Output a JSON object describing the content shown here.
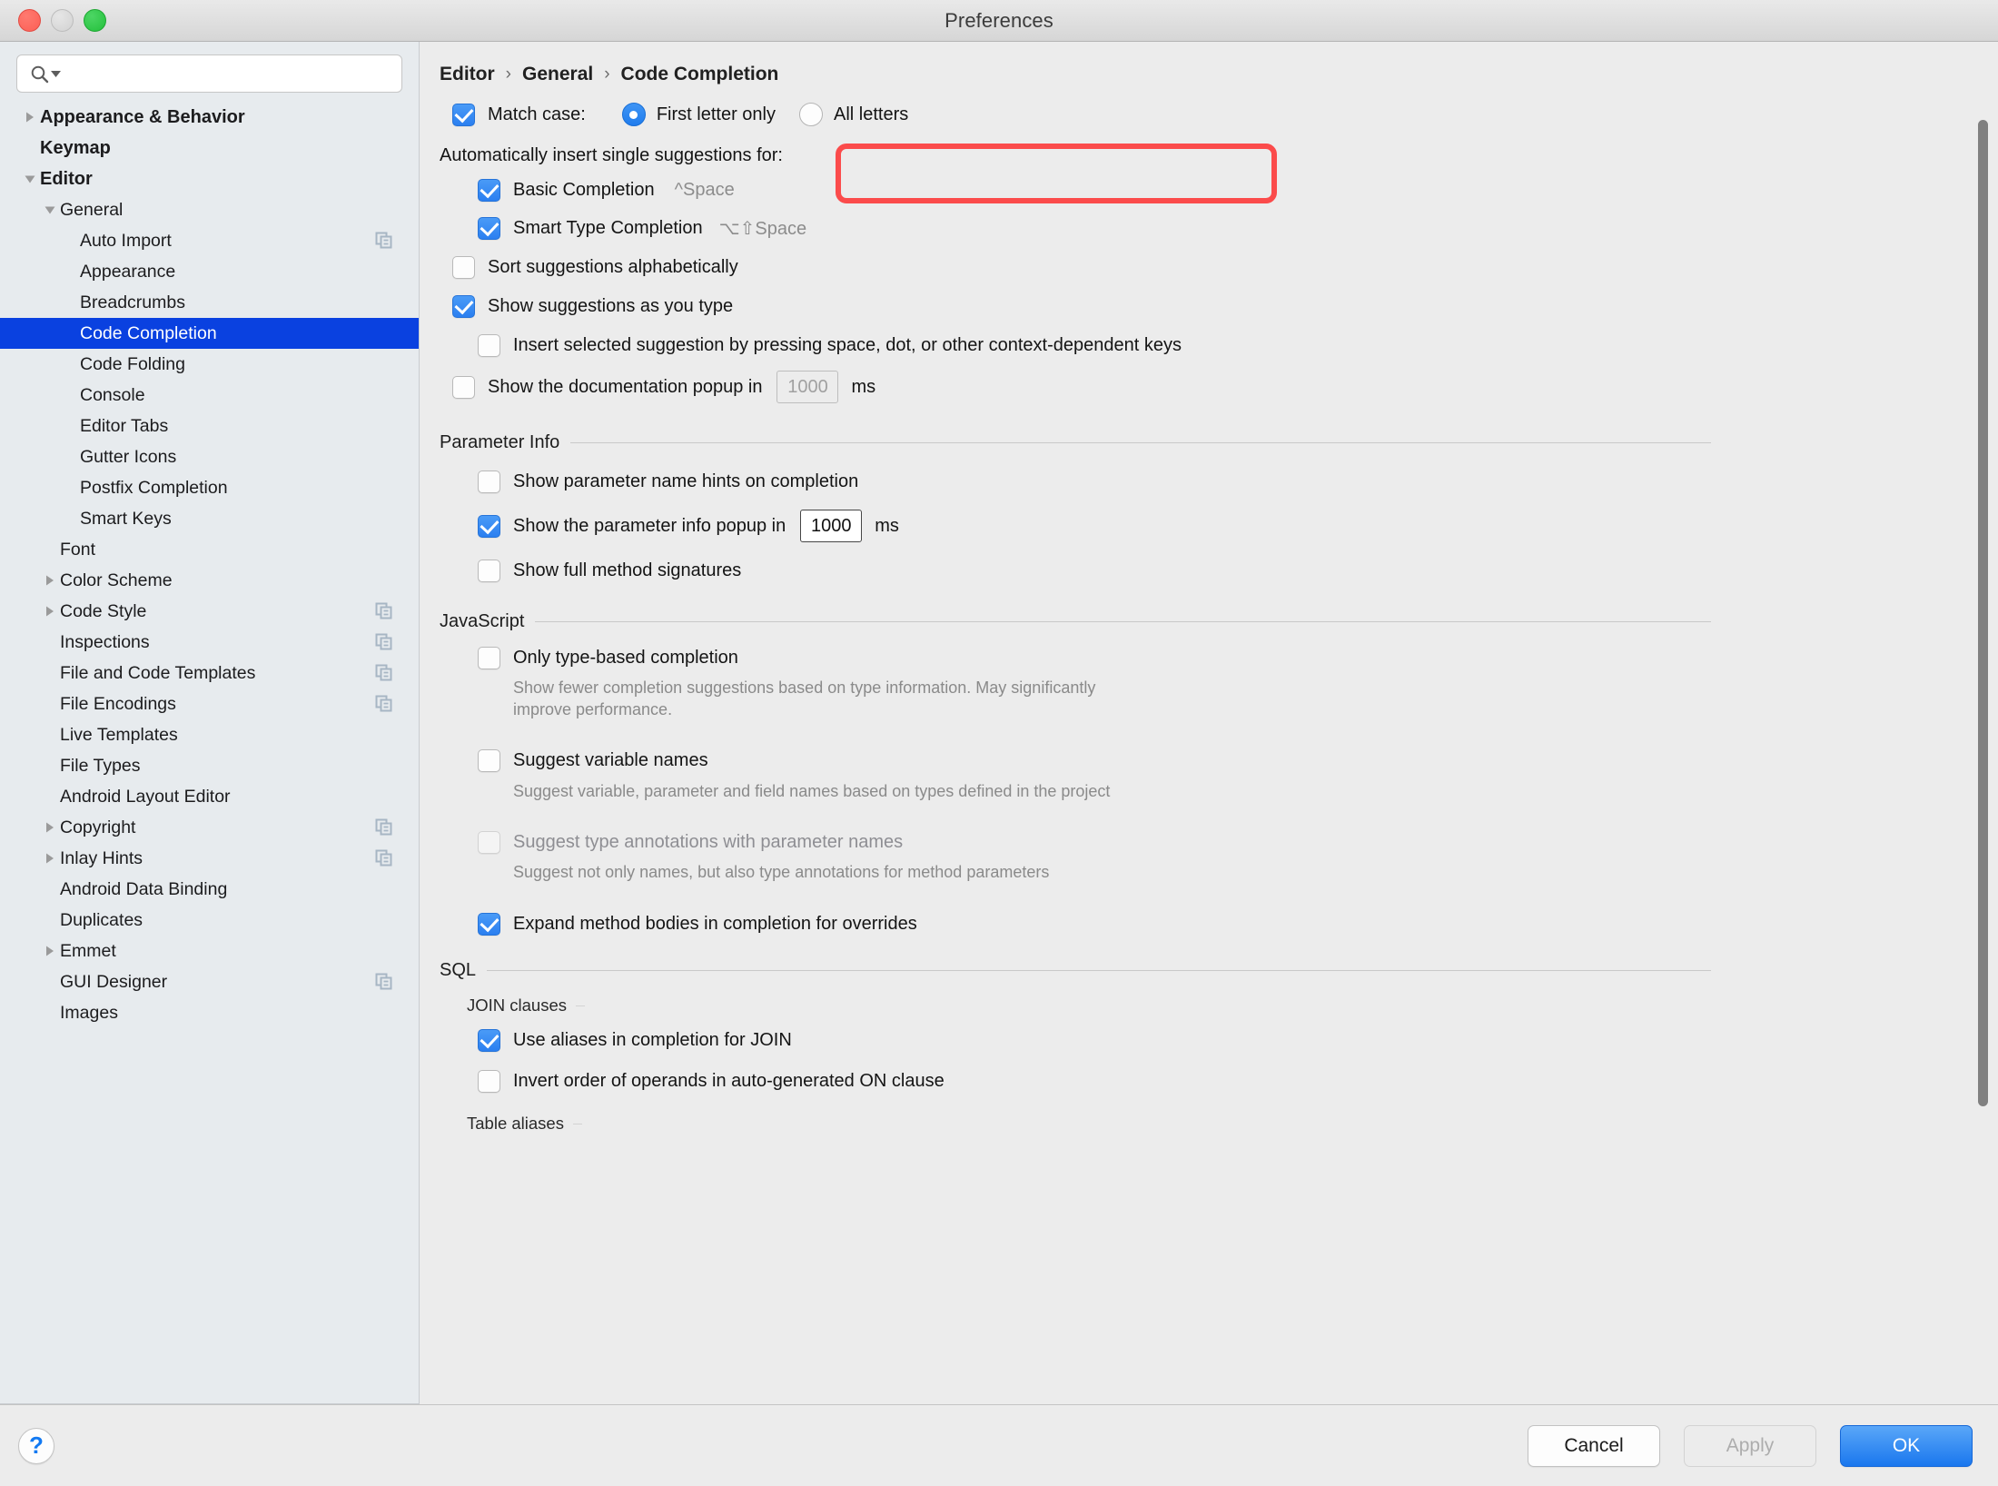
{
  "window": {
    "title": "Preferences"
  },
  "traffic_lights": [
    "close",
    "minimize",
    "zoom"
  ],
  "search": {
    "value": "",
    "placeholder": ""
  },
  "sidebar": {
    "items": [
      {
        "label": "Appearance & Behavior",
        "indent": 0,
        "twisty": "right",
        "bold": true,
        "copy": false,
        "selected": false
      },
      {
        "label": "Keymap",
        "indent": 0,
        "twisty": "none",
        "bold": true,
        "copy": false,
        "selected": false
      },
      {
        "label": "Editor",
        "indent": 0,
        "twisty": "down",
        "bold": true,
        "copy": false,
        "selected": false
      },
      {
        "label": "General",
        "indent": 1,
        "twisty": "down",
        "bold": false,
        "copy": false,
        "selected": false
      },
      {
        "label": "Auto Import",
        "indent": 2,
        "twisty": "none",
        "bold": false,
        "copy": true,
        "selected": false
      },
      {
        "label": "Appearance",
        "indent": 2,
        "twisty": "none",
        "bold": false,
        "copy": false,
        "selected": false
      },
      {
        "label": "Breadcrumbs",
        "indent": 2,
        "twisty": "none",
        "bold": false,
        "copy": false,
        "selected": false
      },
      {
        "label": "Code Completion",
        "indent": 2,
        "twisty": "none",
        "bold": false,
        "copy": false,
        "selected": true
      },
      {
        "label": "Code Folding",
        "indent": 2,
        "twisty": "none",
        "bold": false,
        "copy": false,
        "selected": false
      },
      {
        "label": "Console",
        "indent": 2,
        "twisty": "none",
        "bold": false,
        "copy": false,
        "selected": false
      },
      {
        "label": "Editor Tabs",
        "indent": 2,
        "twisty": "none",
        "bold": false,
        "copy": false,
        "selected": false
      },
      {
        "label": "Gutter Icons",
        "indent": 2,
        "twisty": "none",
        "bold": false,
        "copy": false,
        "selected": false
      },
      {
        "label": "Postfix Completion",
        "indent": 2,
        "twisty": "none",
        "bold": false,
        "copy": false,
        "selected": false
      },
      {
        "label": "Smart Keys",
        "indent": 2,
        "twisty": "none",
        "bold": false,
        "copy": false,
        "selected": false
      },
      {
        "label": "Font",
        "indent": 1,
        "twisty": "none",
        "bold": false,
        "copy": false,
        "selected": false
      },
      {
        "label": "Color Scheme",
        "indent": 1,
        "twisty": "right",
        "bold": false,
        "copy": false,
        "selected": false
      },
      {
        "label": "Code Style",
        "indent": 1,
        "twisty": "right",
        "bold": false,
        "copy": true,
        "selected": false
      },
      {
        "label": "Inspections",
        "indent": 1,
        "twisty": "none",
        "bold": false,
        "copy": true,
        "selected": false
      },
      {
        "label": "File and Code Templates",
        "indent": 1,
        "twisty": "none",
        "bold": false,
        "copy": true,
        "selected": false
      },
      {
        "label": "File Encodings",
        "indent": 1,
        "twisty": "none",
        "bold": false,
        "copy": true,
        "selected": false
      },
      {
        "label": "Live Templates",
        "indent": 1,
        "twisty": "none",
        "bold": false,
        "copy": false,
        "selected": false
      },
      {
        "label": "File Types",
        "indent": 1,
        "twisty": "none",
        "bold": false,
        "copy": false,
        "selected": false
      },
      {
        "label": "Android Layout Editor",
        "indent": 1,
        "twisty": "none",
        "bold": false,
        "copy": false,
        "selected": false
      },
      {
        "label": "Copyright",
        "indent": 1,
        "twisty": "right",
        "bold": false,
        "copy": true,
        "selected": false
      },
      {
        "label": "Inlay Hints",
        "indent": 1,
        "twisty": "right",
        "bold": false,
        "copy": true,
        "selected": false
      },
      {
        "label": "Android Data Binding",
        "indent": 1,
        "twisty": "none",
        "bold": false,
        "copy": false,
        "selected": false
      },
      {
        "label": "Duplicates",
        "indent": 1,
        "twisty": "none",
        "bold": false,
        "copy": false,
        "selected": false
      },
      {
        "label": "Emmet",
        "indent": 1,
        "twisty": "right",
        "bold": false,
        "copy": false,
        "selected": false
      },
      {
        "label": "GUI Designer",
        "indent": 1,
        "twisty": "none",
        "bold": false,
        "copy": true,
        "selected": false
      },
      {
        "label": "Images",
        "indent": 1,
        "twisty": "none",
        "bold": false,
        "copy": false,
        "selected": false
      }
    ]
  },
  "breadcrumb": {
    "items": [
      "Editor",
      "General",
      "Code Completion"
    ],
    "separator": "›"
  },
  "main": {
    "match_case": {
      "checkbox_label": "Match case:",
      "checked": true,
      "options": [
        {
          "label": "First letter only",
          "selected": true
        },
        {
          "label": "All letters",
          "selected": false
        }
      ],
      "highlight_color": "#fb4b4b"
    },
    "auto_insert_label": "Automatically insert single suggestions for:",
    "auto_insert_items": [
      {
        "label": "Basic Completion",
        "shortcut": "^Space",
        "checked": true
      },
      {
        "label": "Smart Type Completion",
        "shortcut": "⌥⇧Space",
        "checked": true
      }
    ],
    "sort_suggestions": {
      "label": "Sort suggestions alphabetically",
      "checked": false
    },
    "show_suggestions": {
      "label": "Show suggestions as you type",
      "checked": true
    },
    "insert_selected": {
      "label": "Insert selected suggestion by pressing space, dot, or other context-dependent keys",
      "checked": false
    },
    "doc_popup": {
      "label_before": "Show the documentation popup in",
      "value": "1000",
      "unit": "ms",
      "checked": false,
      "field_enabled": false
    },
    "parameter_info": {
      "title": "Parameter Info",
      "name_hints": {
        "label": "Show parameter name hints on completion",
        "checked": false
      },
      "popup": {
        "label_before": "Show the parameter info popup in",
        "value": "1000",
        "unit": "ms",
        "checked": true,
        "field_enabled": true
      },
      "full_signatures": {
        "label": "Show full method signatures",
        "checked": false
      }
    },
    "javascript": {
      "title": "JavaScript",
      "items": [
        {
          "label": "Only type-based completion",
          "checked": false,
          "disabled": false,
          "description": "Show fewer completion suggestions based on type information. May significantly improve performance."
        },
        {
          "label": "Suggest variable names",
          "checked": false,
          "disabled": false,
          "description": "Suggest variable, parameter and field names based on types defined in the project"
        },
        {
          "label": "Suggest type annotations with parameter names",
          "checked": false,
          "disabled": true,
          "description": "Suggest not only names, but also type annotations for method parameters"
        }
      ],
      "expand_method_bodies": {
        "label": "Expand method bodies in completion for overrides",
        "checked": true
      }
    },
    "sql": {
      "title": "SQL",
      "join_clauses_label": "JOIN clauses",
      "join_items": [
        {
          "label": "Use aliases in completion for JOIN",
          "checked": true
        },
        {
          "label": "Invert order of operands in auto-generated ON clause",
          "checked": false
        }
      ],
      "table_aliases_label": "Table aliases"
    }
  },
  "footer": {
    "help_label": "?",
    "cancel_label": "Cancel",
    "apply_label": "Apply",
    "apply_disabled": true,
    "ok_label": "OK"
  }
}
